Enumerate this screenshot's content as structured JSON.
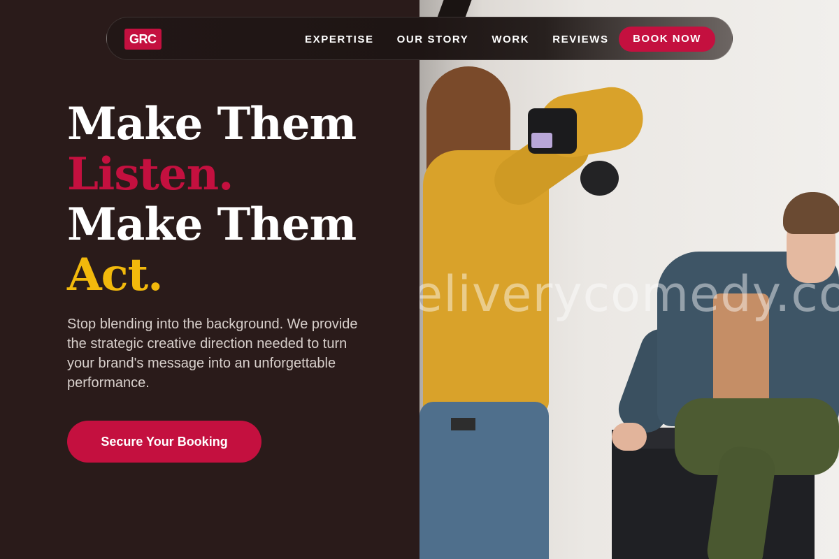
{
  "brand": {
    "logo_text": "GRC",
    "accent_color": "#c4103f",
    "highlight_color": "#f2b90c",
    "background_color": "#2a1b1a"
  },
  "nav": {
    "links": [
      {
        "label": "EXPERTISE"
      },
      {
        "label": "OUR STORY"
      },
      {
        "label": "WORK"
      },
      {
        "label": "REVIEWS"
      }
    ],
    "cta_label": "BOOK NOW"
  },
  "hero": {
    "headline": {
      "line1": "Make Them",
      "line2": "Listen.",
      "line3": "Make Them",
      "line4": "Act."
    },
    "subtext": "Stop blending into the background. We provide the strategic creative direction needed to turn your brand's message into an unforgettable performance.",
    "cta_label": "Secure Your Booking"
  },
  "photo": {
    "watermark": "eliverycomedy.co"
  }
}
